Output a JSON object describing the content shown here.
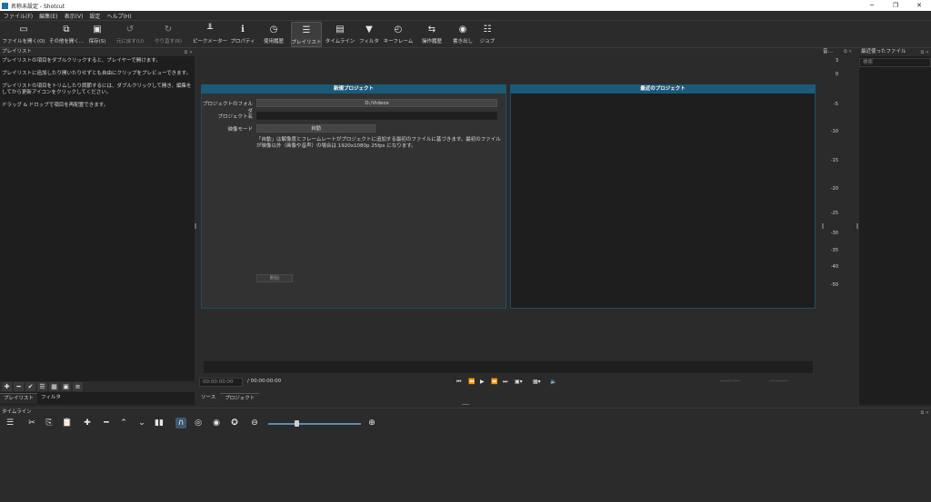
{
  "window": {
    "title": "名称未設定 - Shotcut",
    "controls": [
      "─",
      "❐",
      "✕"
    ]
  },
  "menu": [
    "ファイル(F)",
    "編集(E)",
    "表示(V)",
    "設定",
    "ヘルプ(H)"
  ],
  "toolbar": [
    {
      "label": "ファイルを開く(O)",
      "icon": "folder-open-icon",
      "glyph": "▭"
    },
    {
      "label": "その他を開く...",
      "icon": "open-other-icon",
      "glyph": "⧉"
    },
    {
      "label": "保存(S)",
      "icon": "save-icon",
      "glyph": "▣"
    },
    {
      "label": "元に戻す(U)",
      "icon": "undo-icon",
      "glyph": "↺"
    },
    {
      "label": "やり直す(R)",
      "icon": "redo-icon",
      "glyph": "↻"
    },
    {
      "label": "ピークメーター",
      "icon": "peak-meter-icon",
      "glyph": "╨"
    },
    {
      "label": "プロパティ",
      "icon": "properties-icon",
      "glyph": "ℹ"
    },
    {
      "label": "使用履歴",
      "icon": "history-icon",
      "glyph": "◷"
    },
    {
      "label": "プレイリスト",
      "icon": "playlist-icon",
      "glyph": "☰"
    },
    {
      "label": "タイムライン",
      "icon": "timeline-icon",
      "glyph": "▤"
    },
    {
      "label": "フィルタ",
      "icon": "filter-icon",
      "glyph": "▼"
    },
    {
      "label": "キーフレーム",
      "icon": "keyframe-icon",
      "glyph": "◴"
    },
    {
      "label": "操作履歴",
      "icon": "job-history-icon",
      "glyph": "⇆"
    },
    {
      "label": "書き出し",
      "icon": "export-icon",
      "glyph": "◉"
    },
    {
      "label": "ジョブ",
      "icon": "jobs-icon",
      "glyph": "☷"
    }
  ],
  "playlist": {
    "header": "プレイリスト",
    "tips": [
      "プレイリストの項目をダブルクリックすると、プレイヤーで開けます。",
      "プレイリストに追加したり開いたりせずとも自由にクリップをプレビューできます。",
      "プレイリストの項目をトリムしたり調節するには、ダブルクリックして開き、編集をしてから更新アイコンをクリックしてください。",
      "ドラッグ & ドロップで項目を再配置できます。"
    ],
    "tool_glyphs": [
      "✚",
      "━",
      "✔",
      "☰",
      "▦",
      "▣",
      "≡"
    ],
    "tool_names": [
      "add-icon",
      "remove-icon",
      "update-icon",
      "details-view-icon",
      "tiles-view-icon",
      "icons-view-icon",
      "menu-icon"
    ],
    "tabs": [
      "プレイリスト",
      "フィルタ"
    ]
  },
  "new_project": {
    "title": "新規プロジェクト",
    "folder_label": "プロジェクトのフォルダ",
    "folder_value": "D:/Videos",
    "name_label": "プロジェクト名",
    "name_value": "",
    "mode_label": "映像モード",
    "mode_value": "自動",
    "note": "「自動」は解像度とフレームレートがプロジェクトに追加する最初のファイルに基づきます。最初のファイルが映像以外（画像や音声）の場合は 1920x1080p 25fps になります。",
    "start_button": "開始"
  },
  "recent_projects": {
    "title": "最近のプロジェクト"
  },
  "player": {
    "timecode": "00:00:00:00",
    "total": "/ 00:00:00:00",
    "in_point": "--:--:--:--",
    "out_point": "--:--:--:--",
    "tabs": [
      "ソース",
      "プロジェクト"
    ]
  },
  "meter": {
    "header": "音…",
    "ticks": [
      "3",
      "0",
      "-5",
      "-10",
      "-15",
      "-20",
      "-25",
      "-30",
      "-35",
      "-40",
      "-50"
    ]
  },
  "recent_files": {
    "header": "最近使ったファイル",
    "search_placeholder": "検索"
  },
  "timeline": {
    "header": "タイムライン",
    "tools": [
      "menu-icon",
      "cut-icon",
      "copy-icon",
      "paste-icon",
      "append-icon",
      "remove-icon",
      "lift-icon",
      "overwrite-icon",
      "split-icon",
      "snap-icon",
      "scrub-icon",
      "ripple-icon",
      "ripple-all-icon",
      "zoom-out-icon",
      "zoom-in-icon"
    ],
    "zoom_level": 0.3
  },
  "colors": {
    "accent": "#1b5a78",
    "bg": "#2b2b2b",
    "panel": "#1e1e1e"
  }
}
